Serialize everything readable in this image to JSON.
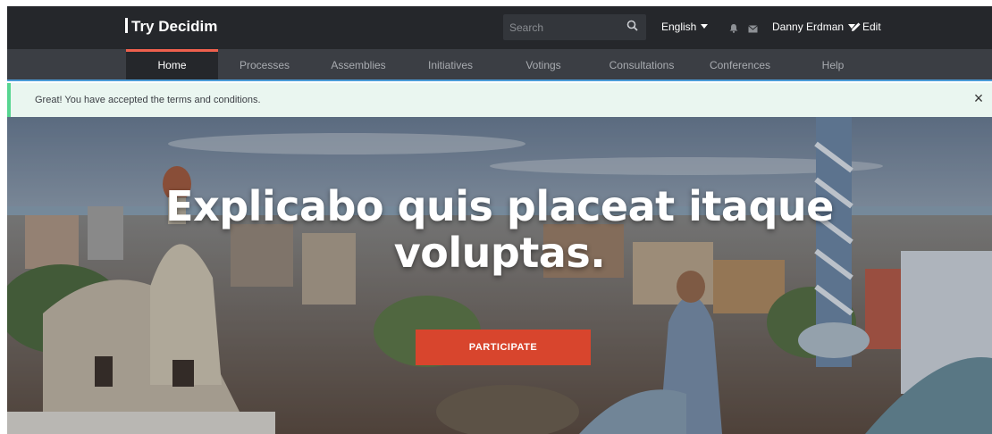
{
  "header": {
    "brand": "Try Decidim",
    "search_placeholder": "Search",
    "language": "English",
    "user_name": "Danny Erdman",
    "edit_label": "Edit"
  },
  "nav": {
    "items": [
      {
        "label": "Home",
        "active": true
      },
      {
        "label": "Processes"
      },
      {
        "label": "Assemblies"
      },
      {
        "label": "Initiatives"
      },
      {
        "label": "Votings"
      },
      {
        "label": "Consultations"
      },
      {
        "label": "Conferences"
      },
      {
        "label": "Help"
      }
    ]
  },
  "callout": {
    "message": "Great! You have accepted the terms and conditions.",
    "close_symbol": "×"
  },
  "hero": {
    "title_line1": "Explicabo quis placeat itaque",
    "title_line2": "voluptas.",
    "cta_label": "PARTICIPATE"
  },
  "colors": {
    "topbar": "#25272b",
    "nav": "#3b3e44",
    "accent_red": "#d8452d",
    "active_underline": "#ef604d",
    "success_bg": "#eaf6f0",
    "success_border": "#57d591"
  },
  "icons": [
    "search-icon",
    "bell-icon",
    "envelope-icon",
    "pencil-icon",
    "close-icon"
  ]
}
